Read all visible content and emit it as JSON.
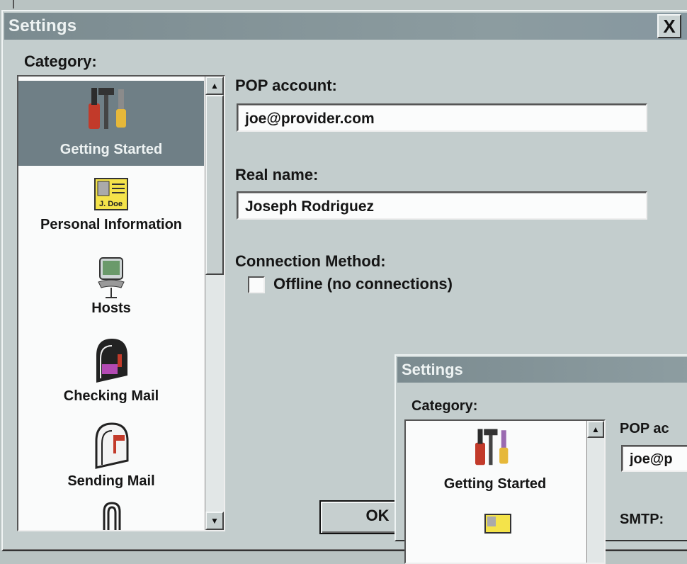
{
  "window": {
    "title": "Settings",
    "close_label": "X",
    "category_label": "Category:",
    "categories": [
      {
        "label": "Getting Started",
        "icon": "tools-icon",
        "selected": true
      },
      {
        "label": "Personal Information",
        "icon": "id-card-icon",
        "selected": false
      },
      {
        "label": "Hosts",
        "icon": "computer-icon",
        "selected": false
      },
      {
        "label": "Checking Mail",
        "icon": "mailbox-icon",
        "selected": false
      },
      {
        "label": "Sending Mail",
        "icon": "mailbox-flag-icon",
        "selected": false
      }
    ],
    "pop_label": "POP account:",
    "pop_value": "joe@provider.com",
    "realname_label": "Real name:",
    "realname_value": "Joseph Rodriguez",
    "connection_label": "Connection Method:",
    "offline_label": "Offline (no connections)",
    "offline_checked": false,
    "ok_label": "OK"
  },
  "nested_window": {
    "title": "Settings",
    "category_label": "Category:",
    "categories": [
      {
        "label": "Getting Started",
        "icon": "tools-icon"
      }
    ],
    "pop_label": "POP ac",
    "pop_value": "joe@p",
    "smtp_label": "SMTP:"
  },
  "colors": {
    "dialog_bg": "#c3cdcd",
    "titlebar": "#7b8b90",
    "selection": "#6f7f86"
  }
}
